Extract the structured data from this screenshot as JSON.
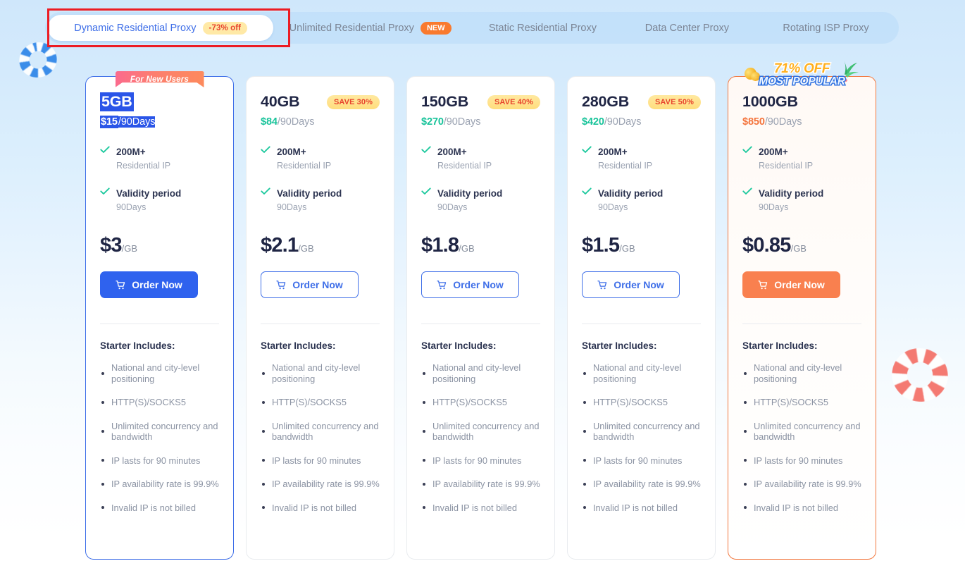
{
  "tabs": [
    {
      "label": "Dynamic Residential Proxy",
      "badge": "-73% off",
      "badge_type": "off",
      "active": true
    },
    {
      "label": "Unlimited Residential Proxy",
      "badge": "NEW",
      "badge_type": "new",
      "active": false
    },
    {
      "label": "Static Residential Proxy",
      "badge": "",
      "badge_type": "",
      "active": false
    },
    {
      "label": "Data Center Proxy",
      "badge": "",
      "badge_type": "",
      "active": false
    },
    {
      "label": "Rotating ISP Proxy",
      "badge": "",
      "badge_type": "",
      "active": false
    }
  ],
  "colors": {
    "accent_blue": "#2f62ee",
    "accent_orange": "#f9804f",
    "teal_price": "#18c39a",
    "badge_yellow": "#ffe9a6",
    "badge_red_text": "#e8442d",
    "annotation_red": "#ec1c24",
    "tick_green": "#1ec99e"
  },
  "common": {
    "feature1_title": "200M+",
    "feature1_sub": "Residential IP",
    "feature2_title": "Validity period",
    "feature2_sub": "90Days",
    "order_label": "Order Now",
    "includes_title": "Starter Includes:",
    "includes": [
      "National and city-level positioning",
      "HTTP(S)/SOCKS5",
      "Unlimited concurrency and bandwidth",
      "IP lasts for 90 minutes",
      "IP availability rate is 99.9%",
      "Invalid IP is not billed"
    ]
  },
  "cards": [
    {
      "size": "5GB",
      "ribbon": "For New Users",
      "save_badge": "",
      "period_price": "$15",
      "period": "/90Days",
      "unit_price": "$3",
      "unit": "/GB",
      "style": "first",
      "selected": true
    },
    {
      "size": "40GB",
      "ribbon": "",
      "save_badge": "SAVE 30%",
      "period_price": "$84",
      "period": "/90Days",
      "unit_price": "$2.1",
      "unit": "/GB",
      "style": "plain",
      "selected": false
    },
    {
      "size": "150GB",
      "ribbon": "",
      "save_badge": "SAVE 40%",
      "period_price": "$270",
      "period": "/90Days",
      "unit_price": "$1.8",
      "unit": "/GB",
      "style": "plain",
      "selected": false
    },
    {
      "size": "280GB",
      "ribbon": "",
      "save_badge": "SAVE 50%",
      "period_price": "$420",
      "period": "/90Days",
      "unit_price": "$1.5",
      "unit": "/GB",
      "style": "plain",
      "selected": false
    },
    {
      "size": "1000GB",
      "ribbon": "",
      "save_badge": "",
      "banner_off": "71% OFF",
      "banner_main": "MOST POPULAR",
      "period_price": "$850",
      "period": "/90Days",
      "unit_price": "$0.85",
      "unit": "/GB",
      "style": "popular",
      "selected": false
    }
  ]
}
